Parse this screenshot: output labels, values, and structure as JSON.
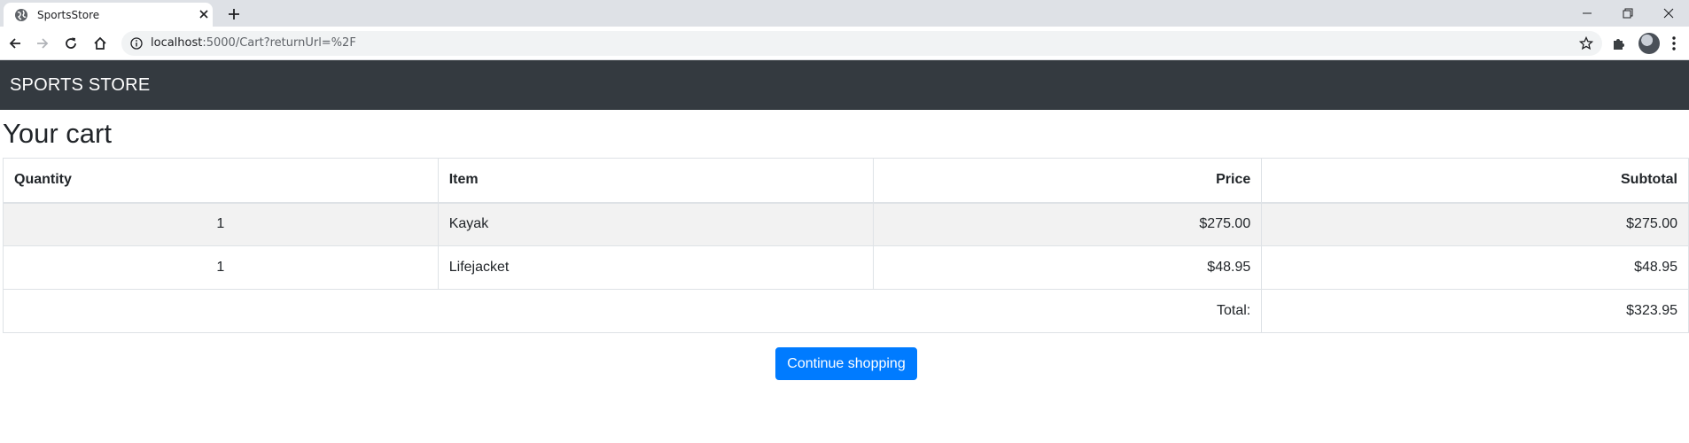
{
  "browser": {
    "tab_title": "SportsStore",
    "url_host": "localhost",
    "url_rest": ":5000/Cart?returnUrl=%2F"
  },
  "page": {
    "brand": "SPORTS STORE",
    "heading": "Your cart",
    "table": {
      "headers": {
        "quantity": "Quantity",
        "item": "Item",
        "price": "Price",
        "subtotal": "Subtotal"
      },
      "rows": [
        {
          "quantity": "1",
          "item": "Kayak",
          "price": "$275.00",
          "subtotal": "$275.00"
        },
        {
          "quantity": "1",
          "item": "Lifejacket",
          "price": "$48.95",
          "subtotal": "$48.95"
        }
      ],
      "total_label": "Total:",
      "total_value": "$323.95"
    },
    "continue_label": "Continue shopping"
  },
  "colors": {
    "navbar": "#343a40",
    "primary_button": "#007bff",
    "striped_row": "#f2f2f2"
  }
}
